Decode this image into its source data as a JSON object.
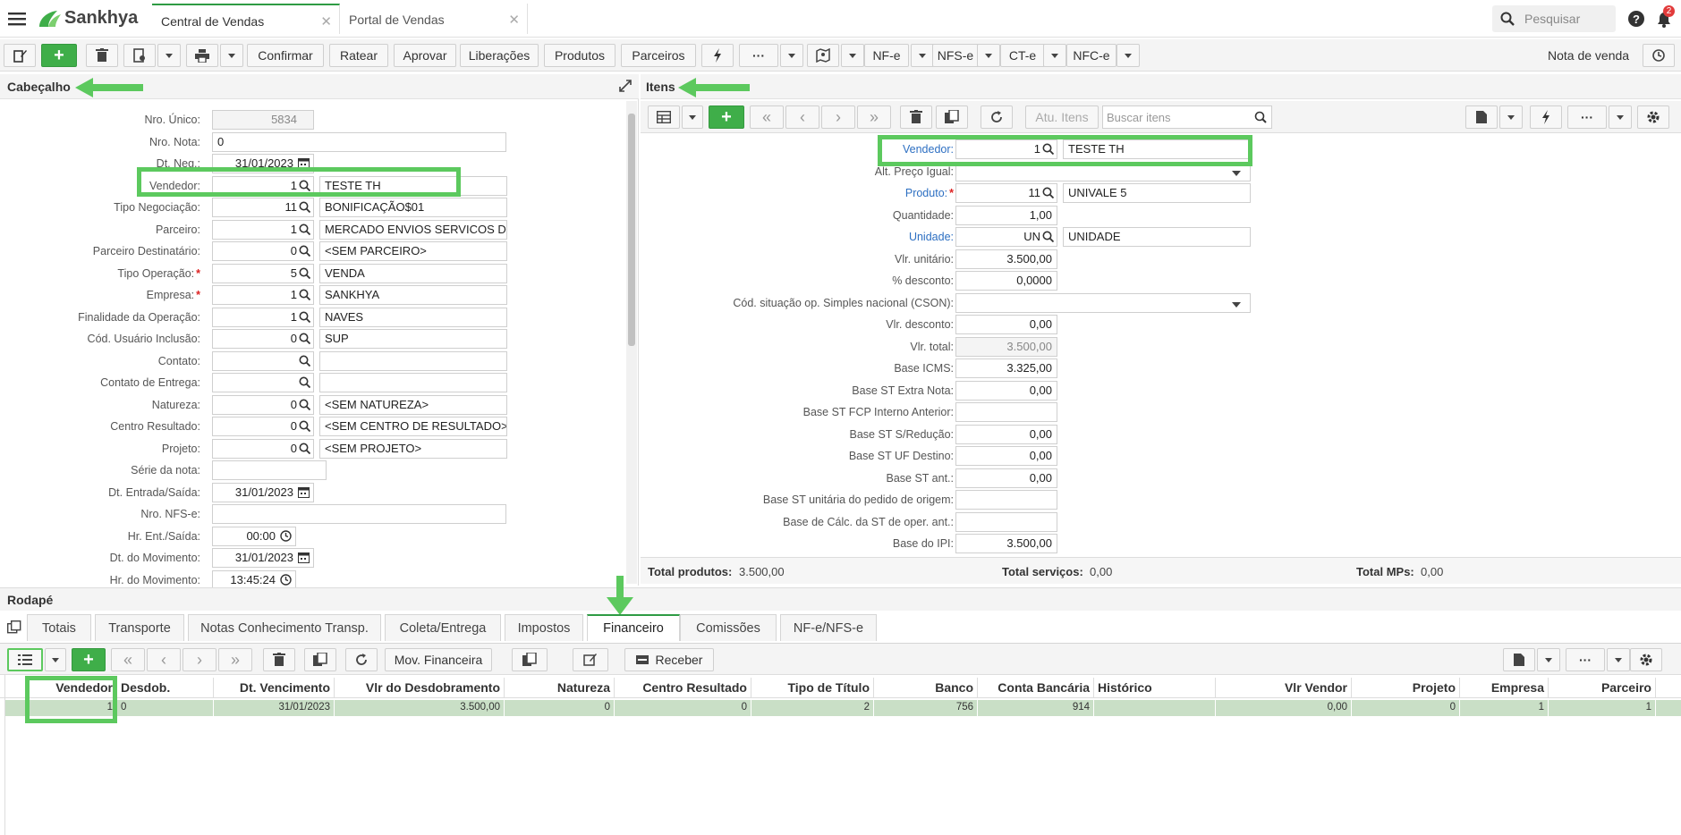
{
  "app": {
    "logo": "Sankhya"
  },
  "tabs": [
    {
      "label": "Central de Vendas"
    },
    {
      "label": "Portal de Vendas"
    }
  ],
  "search": {
    "placeholder": "Pesquisar"
  },
  "notif_count": "2",
  "toolbar": {
    "confirmar": "Confirmar",
    "ratear": "Ratear",
    "aprovar": "Aprovar",
    "liberacoes": "Liberações",
    "produtos": "Produtos",
    "parceiros": "Parceiros",
    "nfe": "NF-e",
    "nfse": "NFS-e",
    "cte": "CT-e",
    "nfce": "NFC-e",
    "right_label": "Nota de venda"
  },
  "header": {
    "title": "Cabeçalho",
    "fields": [
      {
        "label": "Nro. Único:",
        "code": "5834",
        "desc": null,
        "ro": true
      },
      {
        "label": "Nro. Nota:",
        "code": "0",
        "desc": null
      },
      {
        "label": "Dt. Neg.:",
        "code": "31/01/2023",
        "desc": null
      },
      {
        "label": "Vendedor:",
        "code": "1",
        "desc": "TESTE TH"
      },
      {
        "label": "Tipo Negociação:",
        "code": "11",
        "desc": "BONIFICAÇÃO$01"
      },
      {
        "label": "Parceiro:",
        "code": "1",
        "desc": "MERCADO ENVIOS SERVICOS D"
      },
      {
        "label": "Parceiro Destinatário:",
        "code": "0",
        "desc": "<SEM PARCEIRO>"
      },
      {
        "label": "Tipo Operação:",
        "code": "5",
        "desc": "VENDA"
      },
      {
        "label": "Empresa:",
        "code": "1",
        "desc": "SANKHYA"
      },
      {
        "label": "Finalidade da Operação:",
        "code": "1",
        "desc": "NAVES"
      },
      {
        "label": "Cód. Usuário Inclusão:",
        "code": "0",
        "desc": "SUP"
      },
      {
        "label": "Contato:",
        "code": "",
        "desc": ""
      },
      {
        "label": "Contato de Entrega:",
        "code": "",
        "desc": ""
      },
      {
        "label": "Natureza:",
        "code": "0",
        "desc": "<SEM NATUREZA>"
      },
      {
        "label": "Centro Resultado:",
        "code": "0",
        "desc": "<SEM CENTRO DE RESULTADO>"
      },
      {
        "label": "Projeto:",
        "code": "0",
        "desc": "<SEM PROJETO>"
      },
      {
        "label": "Série da nota:",
        "code": "",
        "desc": null
      },
      {
        "label": "Dt. Entrada/Saída:",
        "code": "31/01/2023",
        "desc": null
      },
      {
        "label": "Nro. NFS-e:",
        "code": "",
        "desc": null
      },
      {
        "label": "Hr. Ent./Saída:",
        "code": "00:00",
        "desc": null
      },
      {
        "label": "Dt. do Movimento:",
        "code": "31/01/2023",
        "desc": null
      },
      {
        "label": "Hr. do Movimento:",
        "code": "13:45:24",
        "desc": null
      }
    ]
  },
  "items": {
    "title": "Itens",
    "atu_itens": "Atu. Itens",
    "search_placeholder": "Buscar itens",
    "fields": [
      {
        "label": "Vendedor:",
        "code": "1",
        "desc": "TESTE TH"
      },
      {
        "label": "Alt. Preço Igual:",
        "code": "",
        "desc": null
      },
      {
        "label": "Produto:",
        "code": "11",
        "desc": "UNIVALE 5"
      },
      {
        "label": "Quantidade:",
        "code": "1,00",
        "desc": null
      },
      {
        "label": "Unidade:",
        "code": "UN",
        "desc": "UNIDADE"
      },
      {
        "label": "Vlr. unitário:",
        "code": "3.500,00",
        "desc": null
      },
      {
        "label": "% desconto:",
        "code": "0,0000",
        "desc": null
      },
      {
        "label": "Cód. situação op. Simples nacional (CSON):",
        "code": "",
        "desc": null
      },
      {
        "label": "Vlr. desconto:",
        "code": "0,00",
        "desc": null
      },
      {
        "label": "Vlr. total:",
        "code": "3.500,00",
        "desc": null
      },
      {
        "label": "Base ICMS:",
        "code": "3.325,00",
        "desc": null
      },
      {
        "label": "Base ST Extra Nota:",
        "code": "0,00",
        "desc": null
      },
      {
        "label": "Base ST FCP Interno Anterior:",
        "code": "",
        "desc": null
      },
      {
        "label": "Base ST S/Redução:",
        "code": "0,00",
        "desc": null
      },
      {
        "label": "Base ST UF Destino:",
        "code": "0,00",
        "desc": null
      },
      {
        "label": "Base ST ant.:",
        "code": "0,00",
        "desc": null
      },
      {
        "label": "Base ST unitária do pedido de origem:",
        "code": "",
        "desc": null
      },
      {
        "label": "Base de Cálc. da ST de oper. ant.:",
        "code": "",
        "desc": null
      },
      {
        "label": "Base do IPI:",
        "code": "3.500,00",
        "desc": null
      }
    ],
    "totals": {
      "produtos_label": "Total produtos:",
      "produtos_value": "3.500,00",
      "servicos_label": "Total serviços:",
      "servicos_value": "0,00",
      "mps_label": "Total MPs:",
      "mps_value": "0,00"
    }
  },
  "footer": {
    "title": "Rodapé",
    "tabs": [
      "Totais",
      "Transporte",
      "Notas Conhecimento Transp.",
      "Coleta/Entrega",
      "Impostos",
      "Financeiro",
      "Comissões",
      "NF-e/NFS-e"
    ],
    "mov_financeira": "Mov. Financeira",
    "receber": "Receber",
    "columns": [
      "Vendedor",
      "Desdob.",
      "Dt. Vencimento",
      "Vlr do Desdobramento",
      "Natureza",
      "Centro Resultado",
      "Tipo de Título",
      "Banco",
      "Conta Bancária",
      "Histórico",
      "Vlr Vendor",
      "Projeto",
      "Empresa",
      "Parceiro"
    ],
    "row": [
      "1",
      "0",
      "31/01/2023",
      "3.500,00",
      "0",
      "0",
      "2",
      "756",
      "914",
      "",
      "0,00",
      "0",
      "1",
      "1"
    ]
  },
  "colors": {
    "accent": "#3fae49",
    "highlight": "#5cc95e",
    "link": "#2d6fc2",
    "row": "#c9dfc6"
  }
}
